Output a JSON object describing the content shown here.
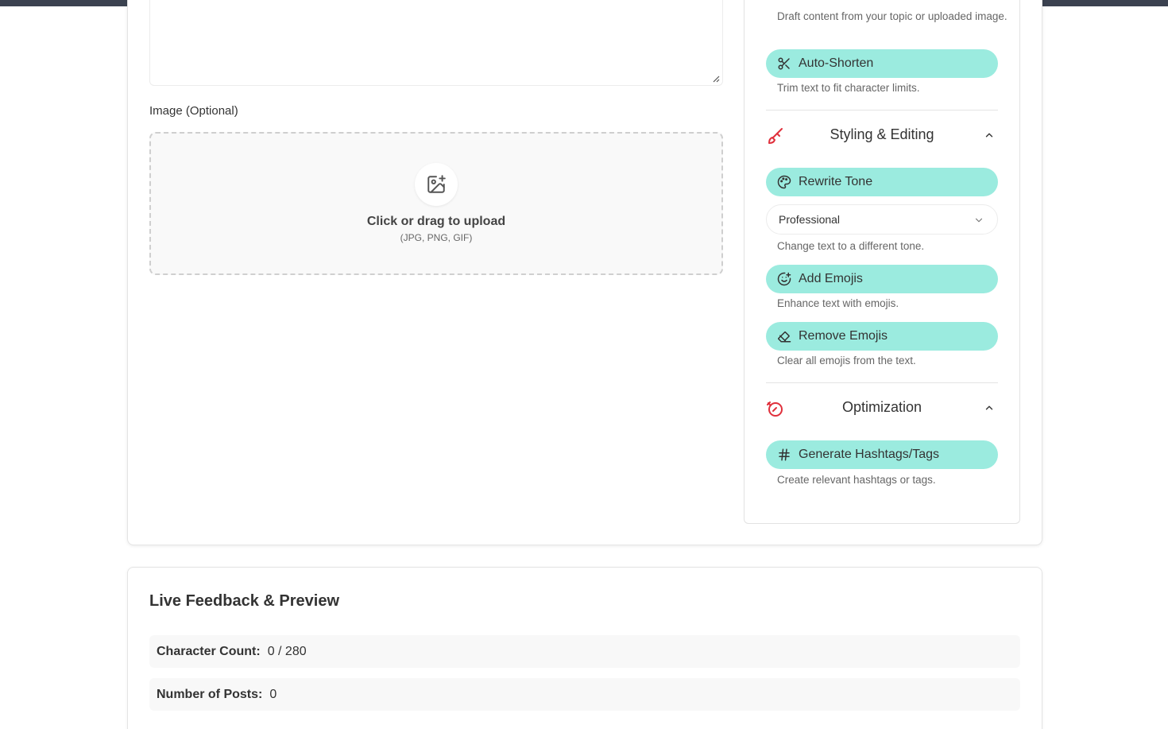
{
  "editor": {
    "image_label": "Image (Optional)",
    "upload_title": "Click or drag to upload",
    "upload_hint": "(JPG, PNG, GIF)"
  },
  "tools": {
    "draft_desc": "Draft content from your topic or uploaded image.",
    "auto_shorten": {
      "label": "Auto-Shorten",
      "desc": "Trim text to fit character limits.",
      "icon": "scissors-icon"
    },
    "styling": {
      "title": "Styling & Editing",
      "icon": "brush-icon",
      "rewrite_tone": {
        "label": "Rewrite Tone",
        "icon": "palette-icon"
      },
      "tone_selected": "Professional",
      "tone_desc": "Change text to a different tone.",
      "add_emojis": {
        "label": "Add Emojis",
        "desc": "Enhance text with emojis.",
        "icon": "smile-plus-icon"
      },
      "remove_emojis": {
        "label": "Remove Emojis",
        "desc": "Clear all emojis from the text.",
        "icon": "eraser-icon"
      }
    },
    "optimization": {
      "title": "Optimization",
      "icon": "gauge-icon",
      "hashtags": {
        "label": "Generate Hashtags/Tags",
        "desc": "Create relevant hashtags or tags.",
        "icon": "hash-icon"
      }
    }
  },
  "feedback": {
    "title": "Live Feedback & Preview",
    "char_count_label": "Character Count:",
    "char_count_value": "0 / 280",
    "posts_label": "Number of Posts:",
    "posts_value": "0"
  },
  "colors": {
    "button_bg": "#9bebdf",
    "accent_icon": "#e0303c",
    "topbar": "#3b4250"
  }
}
